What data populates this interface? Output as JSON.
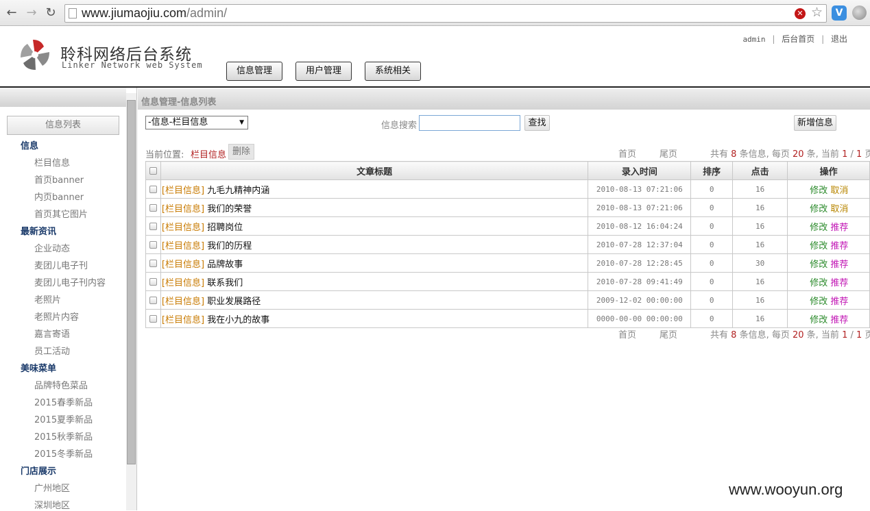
{
  "browser": {
    "url_host": "www.jiumaojiu.com",
    "url_path": "/admin/"
  },
  "header": {
    "title": "聆科网络后台系统",
    "subtitle": "Linker Network web System",
    "links": {
      "user": "admin",
      "home": "后台首页",
      "logout": "退出",
      "sep": "|"
    },
    "tabs": [
      "信息管理",
      "用户管理",
      "系统相关"
    ]
  },
  "sidebar": {
    "title": "信息列表",
    "groups": [
      {
        "name": "信息",
        "items": [
          "栏目信息",
          "首页banner",
          "内页banner",
          "首页其它图片"
        ]
      },
      {
        "name": "最新资讯",
        "items": [
          "企业动态",
          "麦团儿电子刊",
          "麦团儿电子刊内容",
          "老照片",
          "老照片内容",
          "嘉言寄语",
          "员工活动"
        ]
      },
      {
        "name": "美味菜单",
        "items": [
          "品牌特色菜品",
          "2015春季新品",
          "2015夏季新品",
          "2015秋季新品",
          "2015冬季新品"
        ]
      },
      {
        "name": "门店展示",
        "items": [
          "广州地区",
          "深圳地区"
        ]
      }
    ]
  },
  "content": {
    "breadcrumb": "信息管理-信息列表",
    "category_select": "-信息-栏目信息",
    "search_label": "信息搜索",
    "search_value": "",
    "search_button": "查找",
    "add_button": "新增信息",
    "location_label": "当前位置:",
    "location_value": "栏目信息",
    "delete_button": "删除",
    "pager": {
      "first": "首页",
      "last": "尾页",
      "text_a": "共有",
      "total": "8",
      "text_b": "条信息, 每页",
      "per_page": "20",
      "text_c": "条, 当前",
      "current": "1",
      "slash": "/",
      "pages": "1",
      "text_d": "页"
    },
    "columns": [
      "文章标题",
      "录入时间",
      "排序",
      "点击",
      "操作"
    ],
    "rows": [
      {
        "tag": "[栏目信息]",
        "title": "九毛九精神内涵",
        "time": "2010-08-13 07:21:06",
        "order": "0",
        "clicks": "16",
        "op1": "修改",
        "op2": "取消"
      },
      {
        "tag": "[栏目信息]",
        "title": "我们的荣誉",
        "time": "2010-08-13 07:21:06",
        "order": "0",
        "clicks": "16",
        "op1": "修改",
        "op2": "取消"
      },
      {
        "tag": "[栏目信息]",
        "title": "招聘岗位",
        "time": "2010-08-12 16:04:24",
        "order": "0",
        "clicks": "16",
        "op1": "修改",
        "op2": "推荐"
      },
      {
        "tag": "[栏目信息]",
        "title": "我们的历程",
        "time": "2010-07-28 12:37:04",
        "order": "0",
        "clicks": "16",
        "op1": "修改",
        "op2": "推荐"
      },
      {
        "tag": "[栏目信息]",
        "title": "品牌故事",
        "time": "2010-07-28 12:28:45",
        "order": "0",
        "clicks": "30",
        "op1": "修改",
        "op2": "推荐"
      },
      {
        "tag": "[栏目信息]",
        "title": "联系我们",
        "time": "2010-07-28 09:41:49",
        "order": "0",
        "clicks": "16",
        "op1": "修改",
        "op2": "推荐"
      },
      {
        "tag": "[栏目信息]",
        "title": "职业发展路径",
        "time": "2009-12-02 00:00:00",
        "order": "0",
        "clicks": "16",
        "op1": "修改",
        "op2": "推荐"
      },
      {
        "tag": "[栏目信息]",
        "title": "我在小九的故事",
        "time": "0000-00-00 00:00:00",
        "order": "0",
        "clicks": "16",
        "op1": "修改",
        "op2": "推荐"
      }
    ]
  },
  "watermark": "www.wooyun.org",
  "icons": {
    "back": "back-arrow-icon",
    "forward": "forward-arrow-icon",
    "reload": "reload-icon",
    "page": "page-icon",
    "block": "blocked-content-icon",
    "star": "bookmark-star-icon",
    "ext1": "extension-icon",
    "ext2": "globe-extension-icon",
    "logo": "logo-swirl-icon",
    "select_arrow": "dropdown-arrow-icon",
    "checkbox": "checkbox-icon"
  },
  "colors": {
    "tag": "#c87a00",
    "edit": "#2a8a2a",
    "cancel": "#b88600",
    "recommend": "#c218b5",
    "highlight": "#b22222"
  }
}
